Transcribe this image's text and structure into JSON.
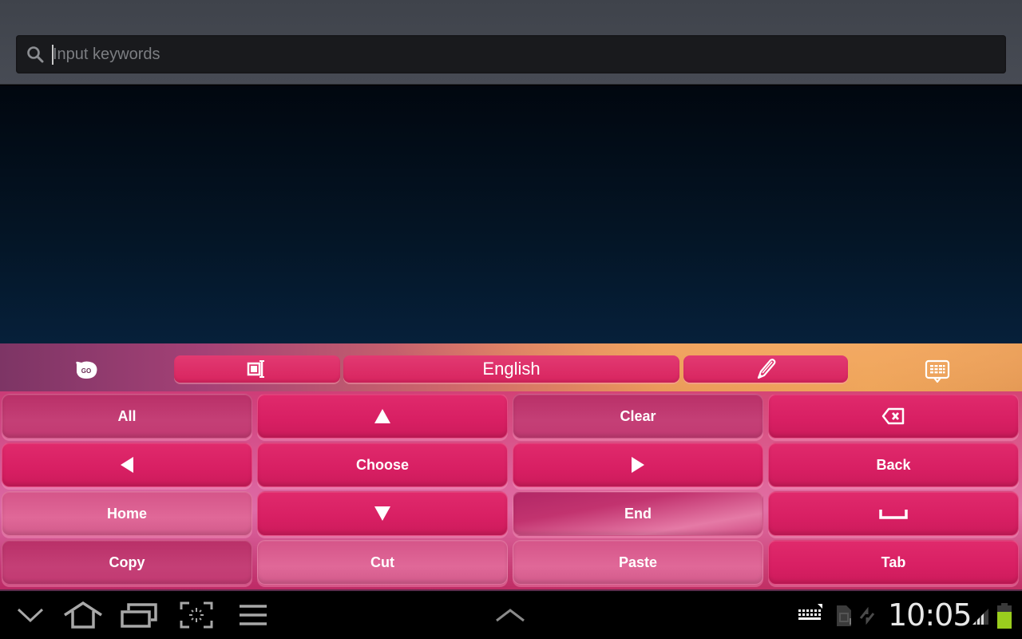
{
  "search": {
    "placeholder": "Input keywords",
    "value": ""
  },
  "keyboard": {
    "toolbar": {
      "logo_text": "GO",
      "language_label": "English",
      "items": [
        {
          "name": "go-logo",
          "icon": "go-keyboard-logo-icon"
        },
        {
          "name": "cursor-select",
          "icon": "text-select-icon"
        },
        {
          "name": "language",
          "label": "English"
        },
        {
          "name": "handwriting",
          "icon": "pen-icon"
        },
        {
          "name": "keyboard-settings",
          "icon": "keyboard-menu-icon"
        }
      ]
    },
    "keys": [
      [
        {
          "label": "All",
          "type": "text"
        },
        {
          "icon": "arrow-up-icon",
          "type": "icon"
        },
        {
          "label": "Clear",
          "type": "text"
        },
        {
          "icon": "backspace-icon",
          "type": "icon"
        }
      ],
      [
        {
          "icon": "arrow-left-icon",
          "type": "icon"
        },
        {
          "label": "Choose",
          "type": "text"
        },
        {
          "icon": "arrow-right-icon",
          "type": "icon"
        },
        {
          "label": "Back",
          "type": "text"
        }
      ],
      [
        {
          "label": "Home",
          "type": "text"
        },
        {
          "icon": "arrow-down-icon",
          "type": "icon"
        },
        {
          "label": "End",
          "type": "text"
        },
        {
          "icon": "space-icon",
          "type": "icon"
        }
      ],
      [
        {
          "label": "Copy",
          "type": "text"
        },
        {
          "label": "Cut",
          "type": "text"
        },
        {
          "label": "Paste",
          "type": "text"
        },
        {
          "label": "Tab",
          "type": "text"
        }
      ]
    ],
    "colors": {
      "key_pink": "#d81f63",
      "accent_orange": "#eea55a",
      "accent_purple": "#7d3565"
    }
  },
  "navbar": {
    "buttons": [
      "back-hide-keyboard-icon",
      "home-icon",
      "recent-apps-icon",
      "screenshot-icon",
      "menu-icon"
    ],
    "center_button": "chevron-up-icon",
    "status": {
      "time": "10:05",
      "battery_color": "#9acd1e"
    }
  }
}
